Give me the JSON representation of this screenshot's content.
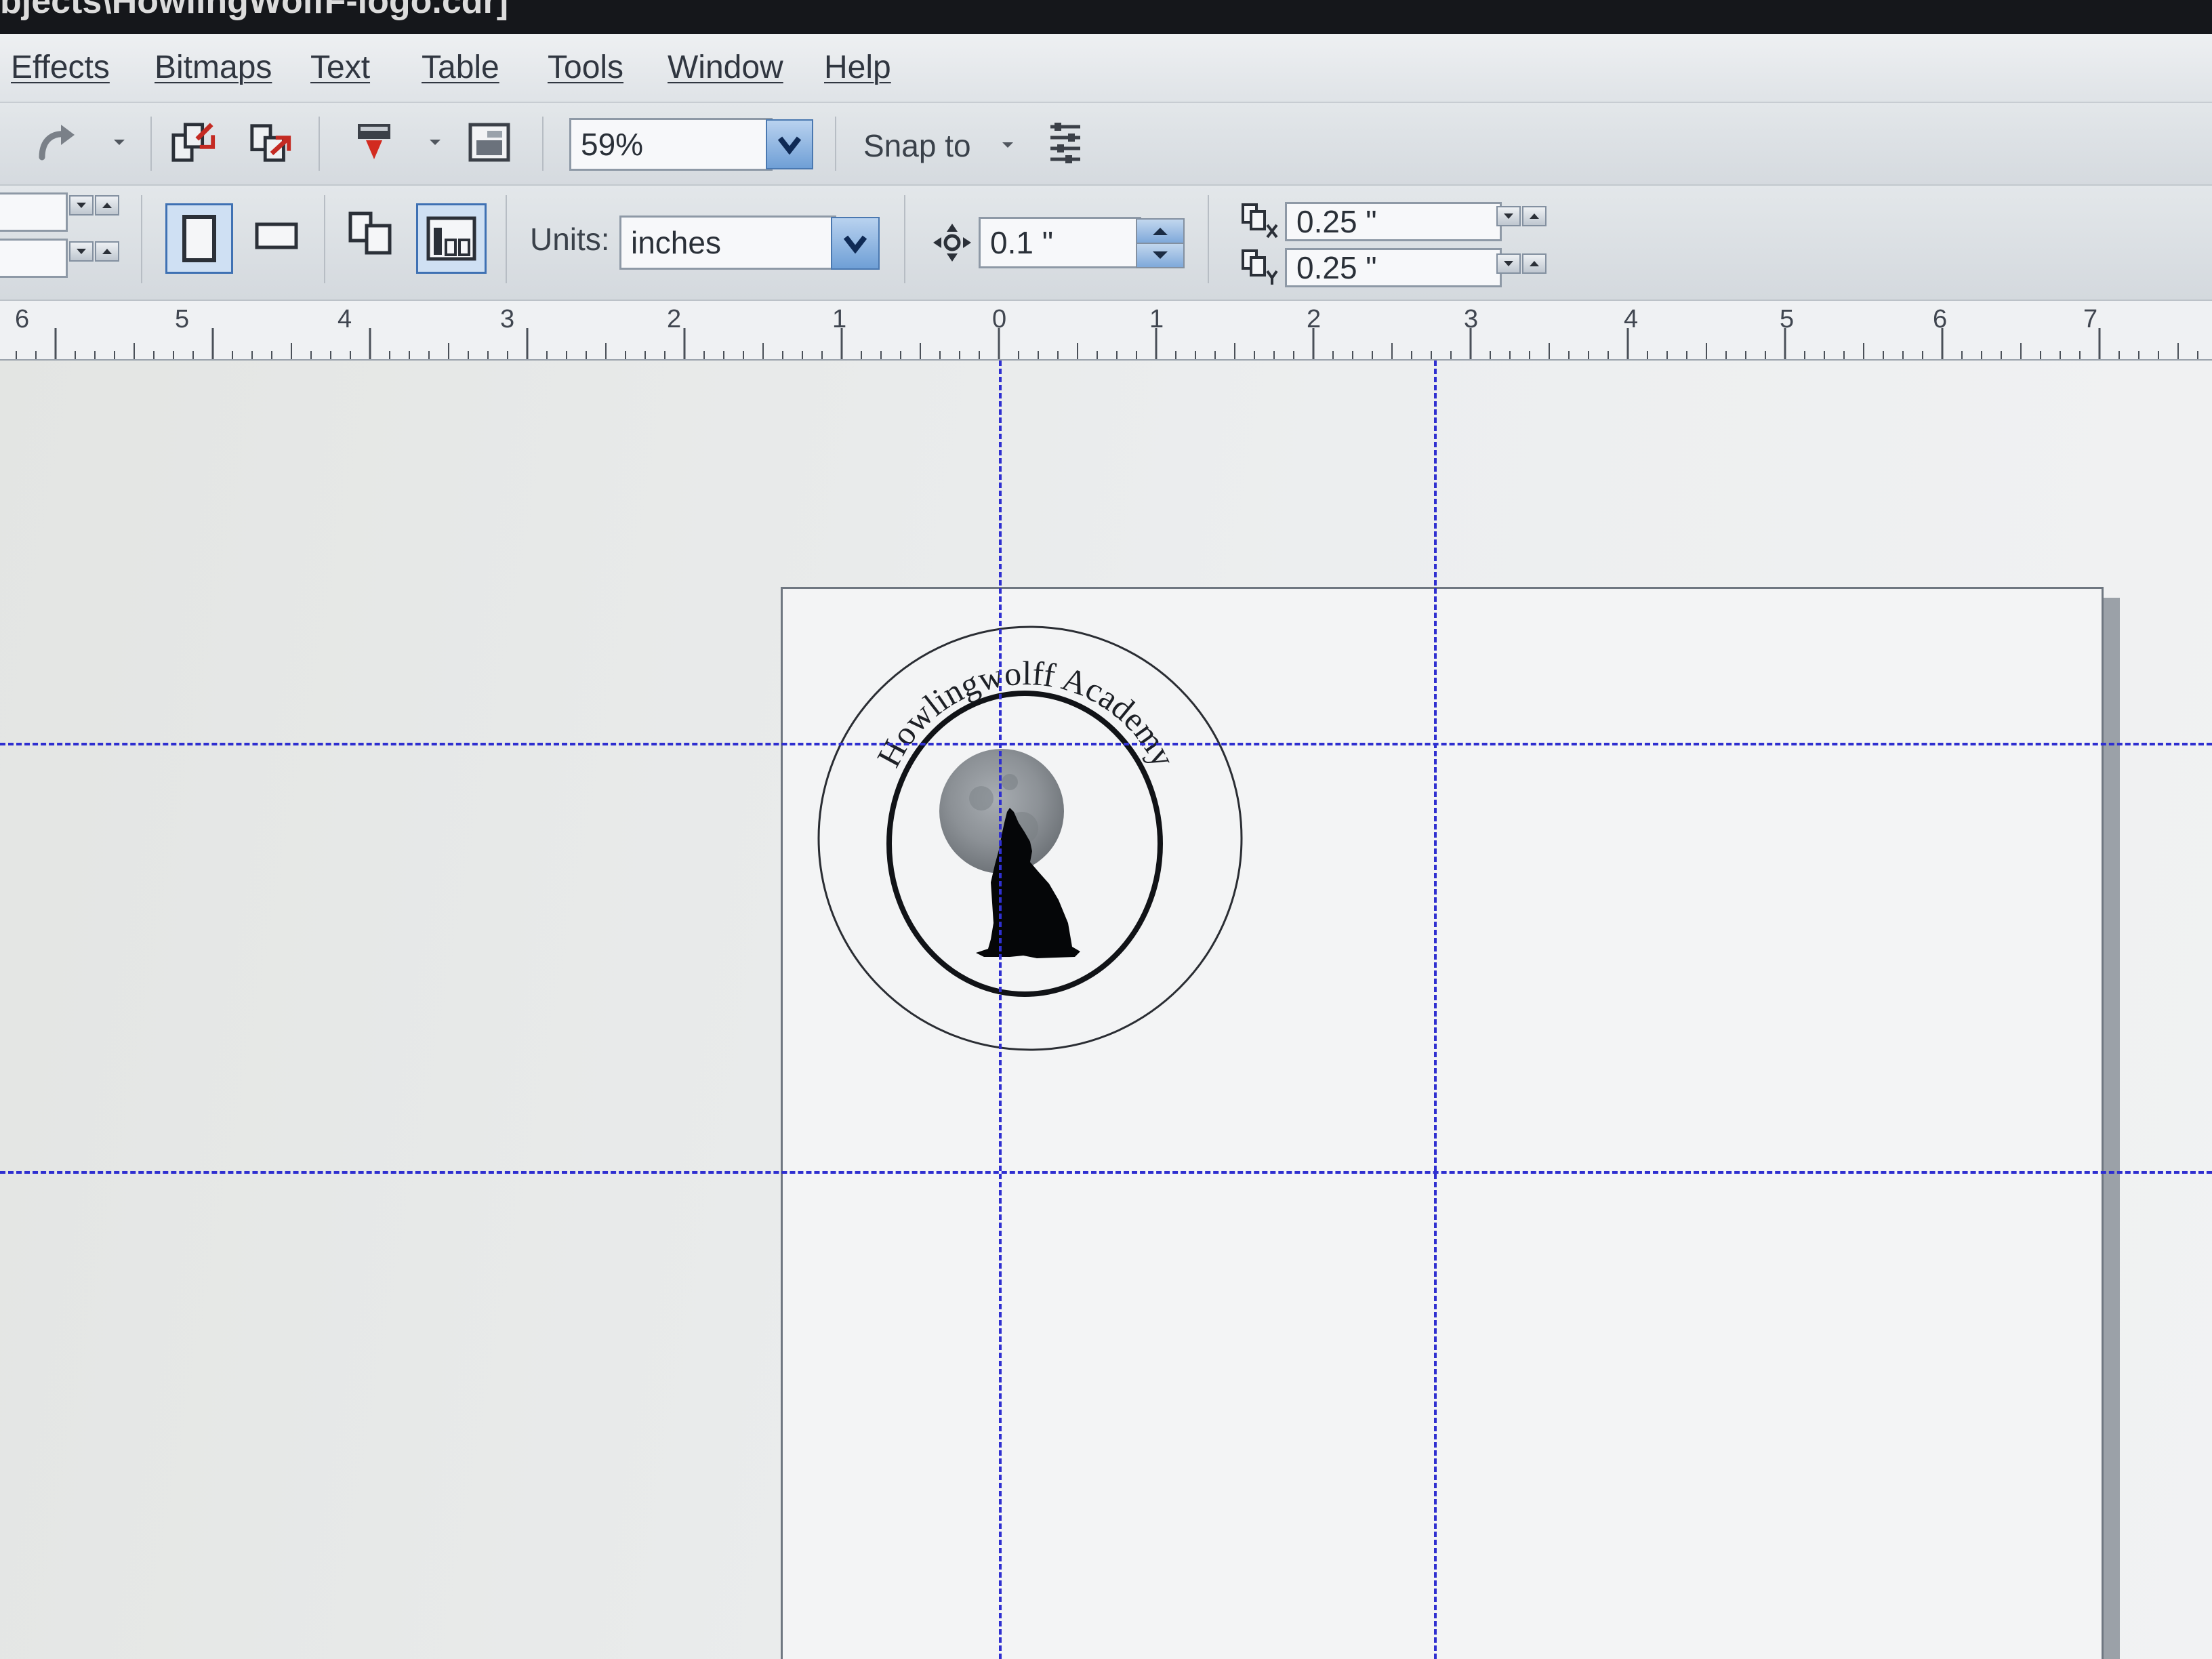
{
  "window": {
    "title": "bjects\\HowlingWolfF-logo.cdr]"
  },
  "menu": [
    {
      "label": "Effects"
    },
    {
      "label": "Bitmaps"
    },
    {
      "label": "Text"
    },
    {
      "label": "Table"
    },
    {
      "label": "Tools"
    },
    {
      "label": "Window"
    },
    {
      "label": "Help"
    }
  ],
  "toolbar": {
    "zoom_value": "59%",
    "snap_label": "Snap to"
  },
  "property_bar": {
    "units_label": "Units:",
    "units_value": "inches",
    "nudge_value": "0.1 \"",
    "duplicate_x": "0.25 \"",
    "duplicate_y": "0.25 \""
  },
  "ruler": {
    "labels": [
      "6",
      "5",
      "4",
      "3",
      "2",
      "1",
      "0",
      "1",
      "2",
      "3",
      "4",
      "5",
      "6",
      "7"
    ]
  },
  "logo": {
    "arc_text": "Howlingwolff Academy",
    "icons": [
      "moon",
      "howling-wolf-silhouette"
    ]
  },
  "colors": {
    "guide": "#2f2fd0",
    "dropdown_button": "#6f9fd6",
    "title_bar": "#15171b"
  }
}
